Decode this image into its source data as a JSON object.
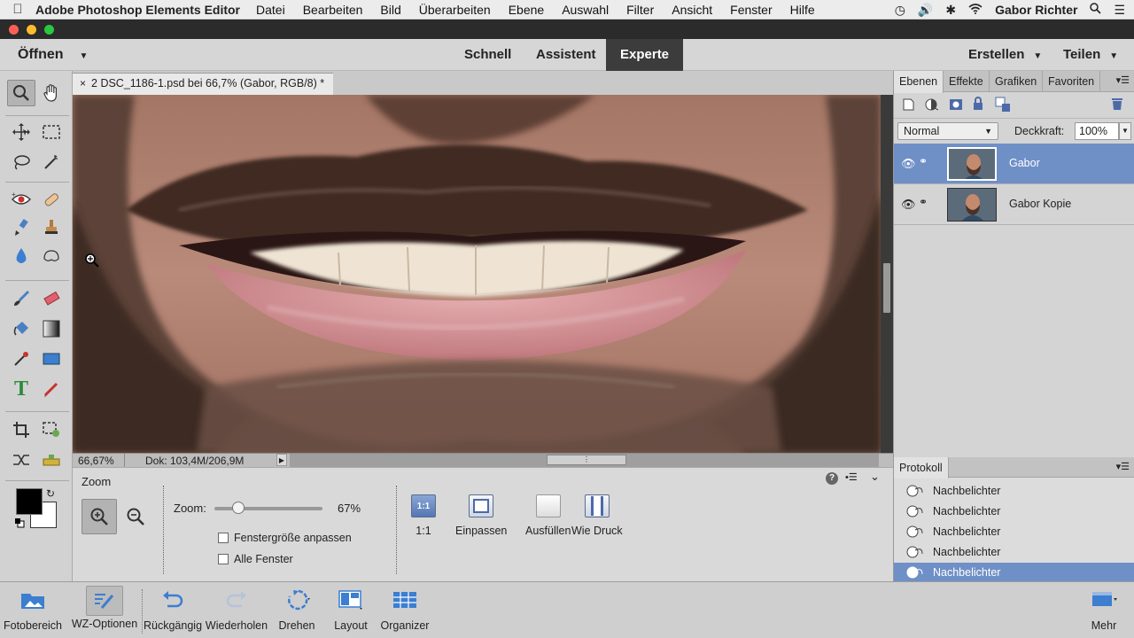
{
  "menubar": {
    "app_name": "Adobe Photoshop Elements Editor",
    "menus": [
      "Datei",
      "Bearbeiten",
      "Bild",
      "Überarbeiten",
      "Ebene",
      "Auswahl",
      "Filter",
      "Ansicht",
      "Fenster",
      "Hilfe"
    ],
    "user": "Gabor Richter"
  },
  "modebar": {
    "open_label": "Öffnen",
    "modes": [
      "Schnell",
      "Assistent",
      "Experte"
    ],
    "active_mode": "Experte",
    "create_label": "Erstellen",
    "share_label": "Teilen"
  },
  "document": {
    "tab_title": "2 DSC_1186-1.psd bei 66,7% (Gabor, RGB/8) *",
    "close_glyph": "×"
  },
  "statusbar": {
    "zoom": "66,67%",
    "doc_size": "Dok: 103,4M/206,9M"
  },
  "options": {
    "title": "Zoom",
    "zoom_label": "Zoom:",
    "zoom_value": "67%",
    "zoom_fraction": 0.22,
    "fit_window_label": "Fenstergröße anpassen",
    "all_windows_label": "Alle Fenster",
    "view_buttons": [
      {
        "label": "1:1",
        "icon_text": "1:1"
      },
      {
        "label": "Einpassen"
      },
      {
        "label": "Ausfüllen"
      },
      {
        "label": "Wie Druck"
      }
    ]
  },
  "layers_panel": {
    "tabs": [
      "Ebenen",
      "Effekte",
      "Grafiken",
      "Favoriten"
    ],
    "blend_mode": "Normal",
    "opacity_label": "Deckkraft:",
    "opacity_value": "100%",
    "layers": [
      {
        "name": "Gabor",
        "selected": true
      },
      {
        "name": "Gabor Kopie",
        "selected": false
      }
    ]
  },
  "history_panel": {
    "title": "Protokoll",
    "items": [
      "Nachbelichter",
      "Nachbelichter",
      "Nachbelichter",
      "Nachbelichter",
      "Nachbelichter"
    ]
  },
  "bottombar": {
    "buttons": [
      "Fotobereich",
      "WZ-Optionen",
      "Rückgängig",
      "Wiederholen",
      "Drehen",
      "Layout",
      "Organizer"
    ],
    "more_label": "Mehr"
  },
  "colors": {
    "selection_blue": "#6f8fc7",
    "foreground": "#000000",
    "background": "#ffffff"
  }
}
